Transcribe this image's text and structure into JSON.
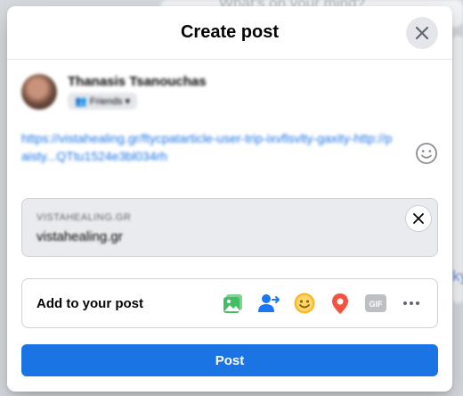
{
  "backdrop": {
    "composer_placeholder": "What's on your mind?",
    "side_text": "ky"
  },
  "modal": {
    "title": "Create post"
  },
  "author": {
    "name": "Thanasis Tsanouchas",
    "audience": "Friends"
  },
  "post": {
    "text": "https://vistahealing.gr/ftycpatarticle-user-trip-ixvflsvlty-gaxity-http://paisty...QTtu1524e3bl034rh"
  },
  "link_preview": {
    "domain": "VISTAHEALING.GR",
    "title": "vistahealing.gr"
  },
  "add_to_post": {
    "label": "Add to your post",
    "icons": [
      "photo-video",
      "tag-people",
      "feeling-activity",
      "check-in",
      "gif",
      "more"
    ]
  },
  "post_button": {
    "label": "Post"
  },
  "colors": {
    "primary": "#1b74e4",
    "photo_green": "#45bd62",
    "tag_blue": "#1877f2",
    "feeling_yellow": "#f7b928",
    "checkin_red": "#f5533d",
    "gif_gray": "#bcc0c4"
  }
}
